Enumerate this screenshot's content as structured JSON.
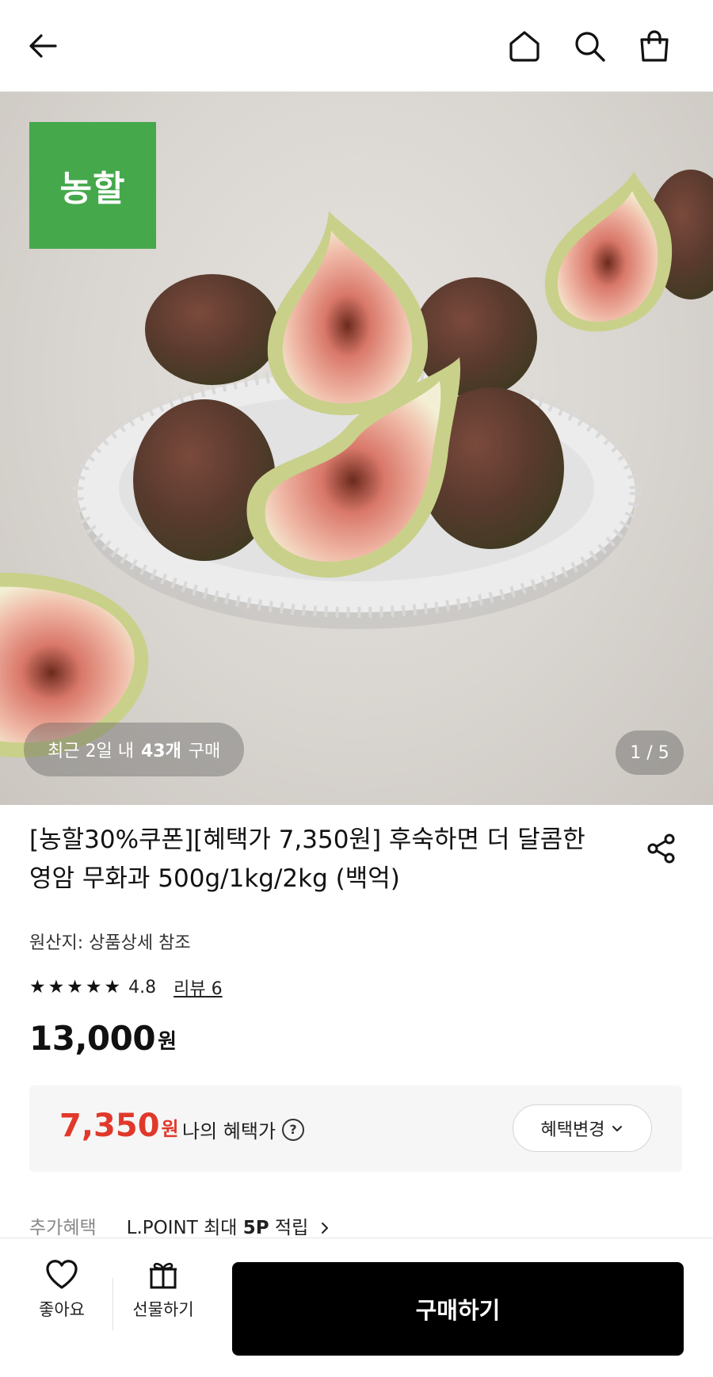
{
  "header": {
    "icons": [
      "back-arrow-icon",
      "home-icon",
      "search-icon",
      "shopping-bag-icon"
    ]
  },
  "hero": {
    "brand_logo": "농할",
    "sold_prefix": "최근 2일 내",
    "sold_count": "43개",
    "sold_suffix": "구매",
    "image_counter": "1 / 5"
  },
  "product": {
    "title": "[농할30%쿠폰][혜택가 7,350원] 후숙하면 더 달콤한 영암 무화과 500g/1kg/2kg (백억)",
    "origin": "원산지: 상품상세 참조",
    "rating": "4.8",
    "star_count": 5,
    "review_link": "리뷰 6",
    "price": "13,000",
    "price_unit": "원"
  },
  "benefit": {
    "price": "7,350",
    "price_unit": "원",
    "label": "나의 혜택가",
    "help": "?",
    "change_button": "혜택변경",
    "accent_color": "#e0392b"
  },
  "extra_benefit": {
    "label": "추가혜택",
    "value_prefix": "L.POINT 최대",
    "value_bold": "5P",
    "value_suffix": "적립"
  },
  "bottom_bar": {
    "like_label": "좋아요",
    "gift_label": "선물하기",
    "buy_label": "구매하기"
  }
}
